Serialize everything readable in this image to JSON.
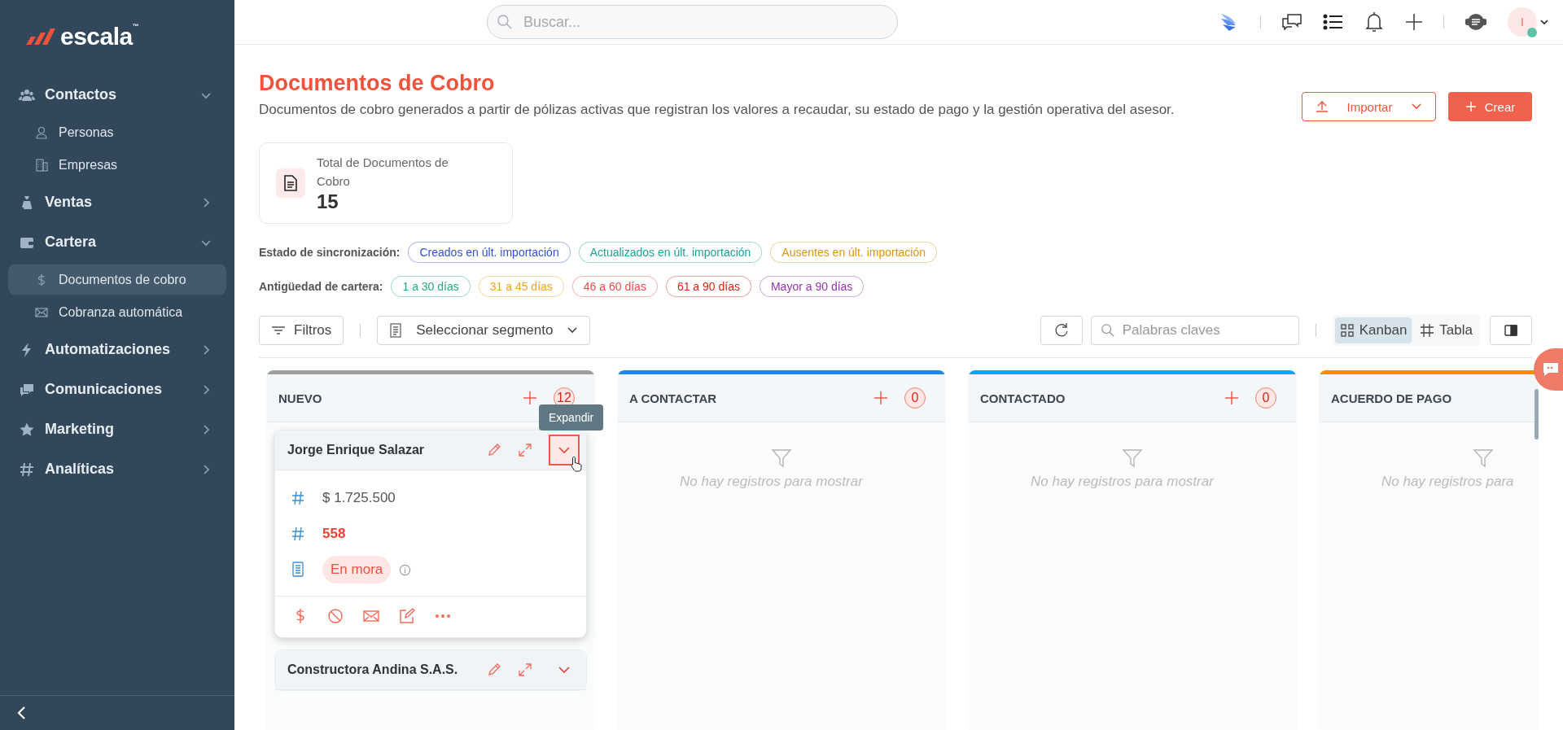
{
  "sidebar": {
    "logo": "escala",
    "logo_mark": "™",
    "items": [
      {
        "label": "Contactos",
        "expanded": true,
        "children": [
          {
            "label": "Personas",
            "selected": false
          },
          {
            "label": "Empresas",
            "selected": false
          }
        ]
      },
      {
        "label": "Ventas",
        "expanded": false
      },
      {
        "label": "Cartera",
        "expanded": true,
        "children": [
          {
            "label": "Documentos de cobro",
            "selected": true
          },
          {
            "label": "Cobranza automática",
            "selected": false
          }
        ]
      },
      {
        "label": "Automatizaciones",
        "expanded": false
      },
      {
        "label": "Comunicaciones",
        "expanded": false
      },
      {
        "label": "Marketing",
        "expanded": false
      },
      {
        "label": "Analíticas",
        "expanded": false
      }
    ]
  },
  "header": {
    "search": {
      "placeholder": "Buscar..."
    },
    "avatar": "I"
  },
  "page": {
    "title": "Documentos de Cobro",
    "description": "Documentos de cobro generados a partir de pólizas activas que registran los valores a recaudar, su estado de pago y la gestión operativa del asesor.",
    "buttons": [
      {
        "label": "Importar",
        "kind": "outline"
      },
      {
        "label": "Crear",
        "kind": "primary"
      }
    ],
    "stat": {
      "label": "Total de Documentos de Cobro",
      "value": "15"
    },
    "filter_groups": [
      {
        "label": "Estado de sincronización:",
        "chips": [
          {
            "label": "Creados en últ. importación",
            "color": "#3450d8"
          },
          {
            "label": "Actualizados en últ. importación",
            "color": "#17a497"
          },
          {
            "label": "Ausentes en últ. importación",
            "color": "#dc9410"
          }
        ]
      },
      {
        "label": "Antigüedad de cartera:",
        "chips": [
          {
            "label": "1 a 30 días",
            "color": "#1fae78"
          },
          {
            "label": "31 a 45 días",
            "color": "#f2a224"
          },
          {
            "label": "46 a 60 días",
            "color": "#ef4b4b"
          },
          {
            "label": "61 a 90 días",
            "color": "#d2271b"
          },
          {
            "label": "Mayor a 90 días",
            "color": "#9a32b0"
          }
        ]
      }
    ]
  },
  "toolbar": {
    "filters": "Filtros",
    "segment": "Seleccionar segmento",
    "keywords": {
      "placeholder": "Palabras claves"
    },
    "views": [
      {
        "label": "Kanban",
        "selected": true
      },
      {
        "label": "Tabla",
        "selected": false
      }
    ]
  },
  "columns": [
    {
      "title": "NUEVO",
      "color": "#9e9e9e",
      "count": "12",
      "cards": [
        {
          "name": "Jorge Enrique Salazar",
          "expanded": true,
          "highlighted": true,
          "tooltip": "Expandir",
          "amount": "$ 1.725.500",
          "number": "558",
          "status": "En mora"
        },
        {
          "name": "Constructora Andina S.A.S.",
          "expanded": false,
          "highlighted": false
        }
      ]
    },
    {
      "title": "A CONTACTAR",
      "color": "#1e88e5",
      "count": "0",
      "empty_text": "No hay registros para mostrar"
    },
    {
      "title": "CONTACTADO",
      "color": "#03a9f4",
      "count": "0",
      "empty_text": "No hay registros para mostrar"
    },
    {
      "title": "ACUERDO DE PAGO",
      "color": "#fb8c00",
      "empty_text": "No hay registros para"
    }
  ]
}
